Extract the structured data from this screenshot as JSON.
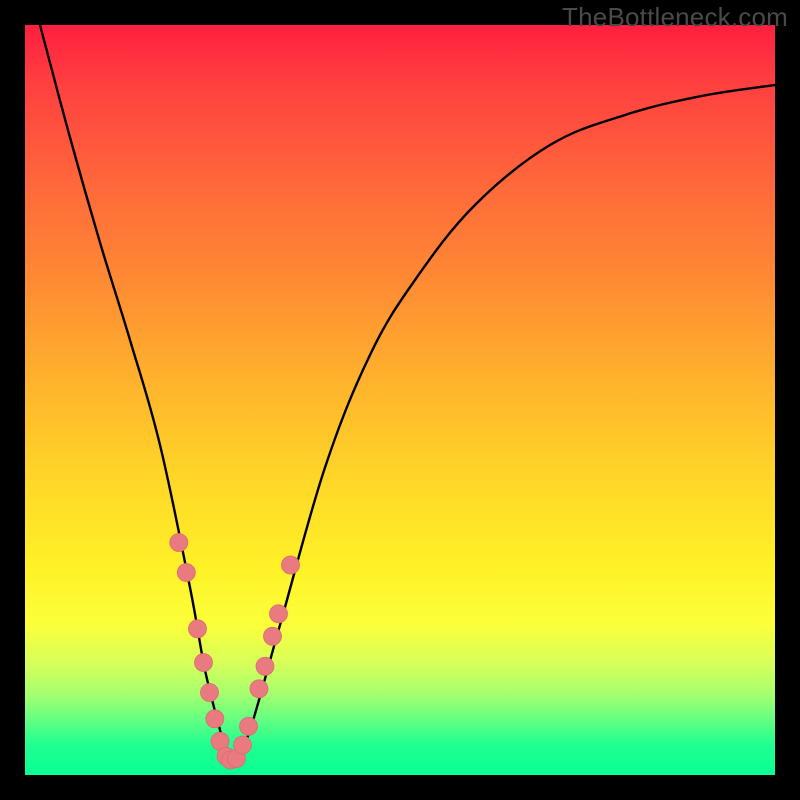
{
  "watermark": "TheBottleneck.com",
  "colors": {
    "curve": "#000000",
    "marker_fill": "#e87a80",
    "marker_stroke": "#d96b72",
    "gradient_top": "#ff1f3f",
    "gradient_bottom": "#0aff95"
  },
  "chart_data": {
    "type": "line",
    "title": "",
    "xlabel": "",
    "ylabel": "",
    "xlim": [
      0,
      100
    ],
    "ylim": [
      0,
      100
    ],
    "note": "Axes are unlabeled; values are pixel-position estimates on a 0–100 grid where (0,0) is bottom-left.",
    "series": [
      {
        "name": "bottleneck-curve",
        "x": [
          2,
          6,
          10,
          14,
          18,
          22,
          24,
          26,
          27,
          28,
          30,
          34,
          40,
          46,
          52,
          60,
          70,
          80,
          90,
          100
        ],
        "y": [
          100,
          85,
          71,
          58,
          44,
          25,
          14,
          6,
          2,
          2,
          6,
          20,
          41,
          56,
          66,
          76,
          84,
          88,
          90.5,
          92
        ]
      }
    ],
    "markers": {
      "name": "highlight-points",
      "shape": "circle",
      "radius_px": 9,
      "x": [
        20.5,
        21.5,
        23.0,
        23.8,
        24.6,
        25.3,
        26.0,
        26.8,
        27.4,
        28.2,
        29.0,
        29.8,
        31.2,
        32.0,
        33.0,
        33.8,
        35.4
      ],
      "y": [
        31.0,
        27.0,
        19.5,
        15.0,
        11.0,
        7.5,
        4.5,
        2.5,
        2.0,
        2.2,
        4.0,
        6.5,
        11.5,
        14.5,
        18.5,
        21.5,
        28.0
      ]
    }
  }
}
